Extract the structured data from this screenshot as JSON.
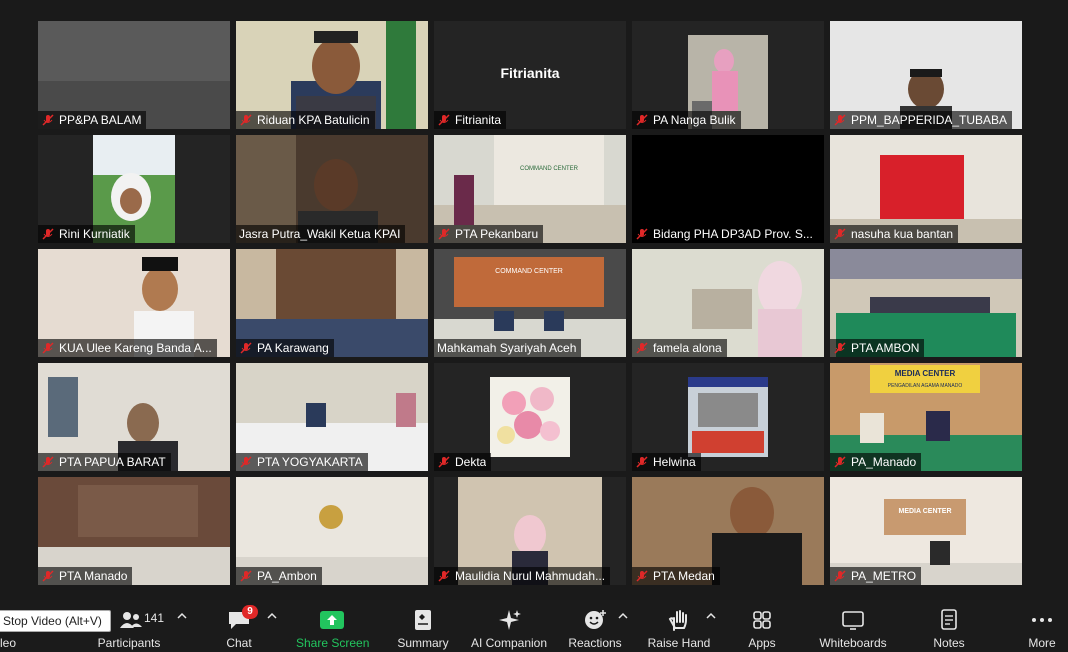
{
  "participants_grid": [
    {
      "name": "PP&PA BALAM"
    },
    {
      "name": "Riduan KPA Batulicin"
    },
    {
      "name": "Fitrianita",
      "center_label": "Fitrianita"
    },
    {
      "name": "PA Nanga Bulik"
    },
    {
      "name": "PPM_BAPPERIDA_TUBABA"
    },
    {
      "name": "Rini Kurniatik"
    },
    {
      "name": "Jasra Putra_Wakil Ketua KPAI",
      "speaking": true
    },
    {
      "name": "PTA Pekanbaru"
    },
    {
      "name": "Bidang PHA DP3AD Prov. S..."
    },
    {
      "name": "nasuha kua bantan"
    },
    {
      "name": "KUA Ulee Kareng Banda A..."
    },
    {
      "name": "PA Karawang"
    },
    {
      "name": "Mahkamah Syariyah Aceh"
    },
    {
      "name": "famela alona"
    },
    {
      "name": "PTA AMBON"
    },
    {
      "name": "PTA PAPUA BARAT"
    },
    {
      "name": "PTA YOGYAKARTA"
    },
    {
      "name": "Dekta"
    },
    {
      "name": "Helwina"
    },
    {
      "name": "PA_Manado"
    },
    {
      "name": "PTA Manado"
    },
    {
      "name": "PA_Ambon"
    },
    {
      "name": "Maulidia Nurul Mahmudah..."
    },
    {
      "name": "PTA Medan"
    },
    {
      "name": "PA_METRO"
    }
  ],
  "scene_text": {
    "pekanbaru_sign": "COMMAND CENTER",
    "aceh_sign": "COMMAND CENTER",
    "manado_sign": "MEDIA CENTER",
    "manado_sub": "PENGADILAN AGAMA MANADO",
    "metro_sign": "MEDIA CENTER"
  },
  "toolbar": {
    "tooltip": "Stop Video (Alt+V)",
    "video_label_partial": "leo",
    "participants_count": "141",
    "participants_label": "Participants",
    "chat_label": "Chat",
    "chat_badge": "9",
    "share_label": "Share Screen",
    "summary_label": "Summary",
    "ai_label": "AI Companion",
    "reactions_label": "Reactions",
    "raise_hand_label": "Raise Hand",
    "apps_label": "Apps",
    "whiteboards_label": "Whiteboards",
    "notes_label": "Notes",
    "more_label": "More"
  },
  "colors": {
    "share_green": "#22c55e",
    "muted_red": "#e02828",
    "speaker_border": "#e6e67a"
  }
}
